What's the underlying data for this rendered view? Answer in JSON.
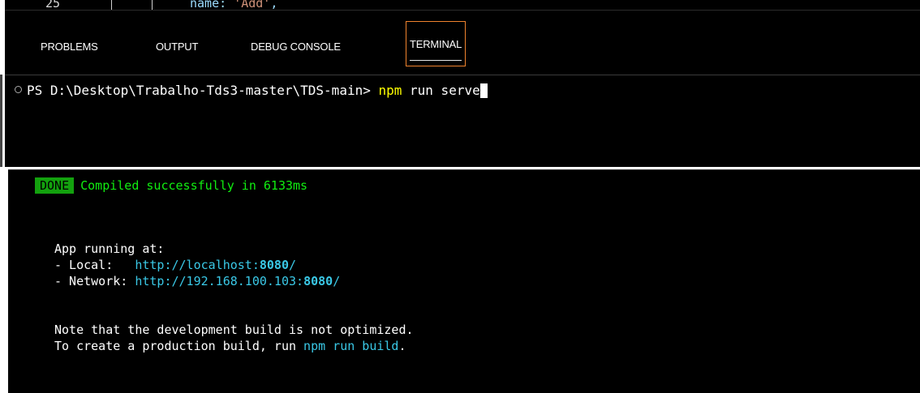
{
  "editor_peek": {
    "line_number": "25",
    "code_key": "name:",
    "code_value": "'Add'",
    "code_tail": ","
  },
  "panel_tabs": [
    {
      "label": "PROBLEMS",
      "active": false
    },
    {
      "label": "OUTPUT",
      "active": false
    },
    {
      "label": "DEBUG CONSOLE",
      "active": false
    },
    {
      "label": "TERMINAL",
      "active": true
    }
  ],
  "terminal_prompt": {
    "prompt": "PS D:\\Desktop\\Trabalho-Tds3-master\\TDS-main>",
    "command_name": "npm",
    "command_args": " run serve"
  },
  "build_output": {
    "status_badge": "DONE",
    "status_message": "Compiled successfully in 6133ms",
    "app_running": "App running at:",
    "local_label": "- Local:   ",
    "local_url": "http://localhost:",
    "local_port": "8080",
    "local_suffix": "/",
    "network_label": "- Network: ",
    "network_url": "http://192.168.100.103:",
    "network_port": "8080",
    "network_suffix": "/",
    "note": "Note that the development build is not optimized.",
    "prod_prefix": "To create a production build, run ",
    "prod_command": "npm run build",
    "prod_suffix": "."
  },
  "colors": {
    "background": "#000000",
    "active_tab_border": "#f0832e",
    "npm_highlight": "#ffff00",
    "done_badge": "#13a10e",
    "success_text": "#11ee11",
    "url": "#3ac8e6"
  }
}
